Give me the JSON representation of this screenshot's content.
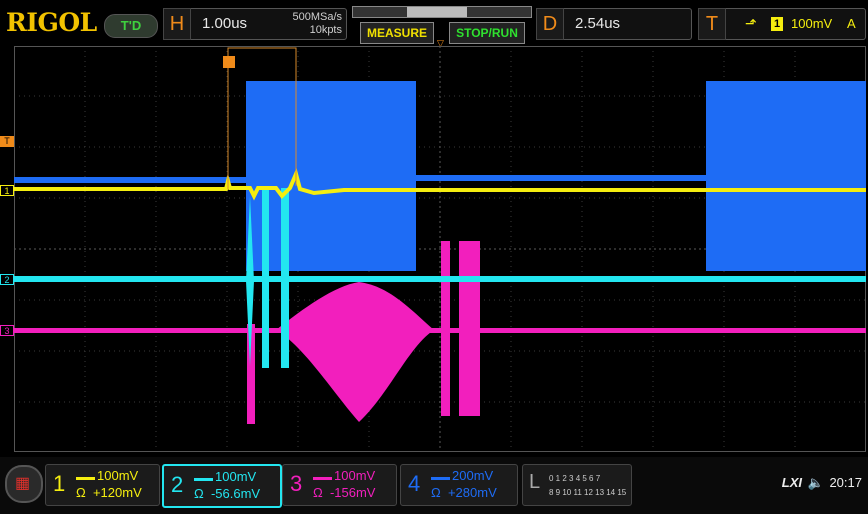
{
  "brand": "RIGOL",
  "run_status": "T'D",
  "horizontal": {
    "letter": "H",
    "timebase": "1.00us",
    "sample_rate": "500MSa/s",
    "memory_depth": "10kpts"
  },
  "buttons": {
    "measure": "MEASURE",
    "stop_run": "STOP/RUN"
  },
  "delay": {
    "letter": "D",
    "value": "2.54us"
  },
  "trigger": {
    "letter": "T",
    "channel": "1",
    "level": "100mV",
    "mode": "A"
  },
  "channels": [
    {
      "num": "1",
      "scale": "100mV",
      "unit": "Ω",
      "offset": "+120mV",
      "color": "#f5ee0f"
    },
    {
      "num": "2",
      "scale": "100mV",
      "unit": "Ω",
      "offset": "-56.6mV",
      "color": "#23e6f0"
    },
    {
      "num": "3",
      "scale": "100mV",
      "unit": "Ω",
      "offset": "-156mV",
      "color": "#f21fbd"
    },
    {
      "num": "4",
      "scale": "200mV",
      "unit": "Ω",
      "offset": "+280mV",
      "color": "#1e6cf5"
    }
  ],
  "logic": {
    "letter": "L",
    "row1": "0 1 2 3  4 5 6 7",
    "row2": "8 9 10 11 12 13 14 15"
  },
  "status": {
    "lxi": "LXI",
    "time": "20:17"
  },
  "markers": {
    "trigger_label": "T",
    "ch1": "1",
    "ch2": "2",
    "ch3": "3"
  }
}
